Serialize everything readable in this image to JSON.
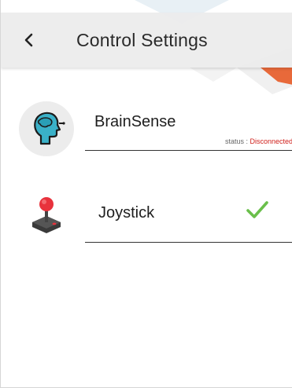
{
  "header": {
    "title": "Control Settings"
  },
  "devices": [
    {
      "name": "BrainSense",
      "icon": "brain-head-icon",
      "status_label": "status : ",
      "status_value": "Disconnected",
      "status_color": "#d0211c"
    },
    {
      "name": "Joystick",
      "icon": "joystick-icon",
      "selected": true,
      "check_color": "#6abf4b"
    }
  ],
  "colors": {
    "header_bg": "#ececec",
    "accent_orange": "#e8693a",
    "brain_icon_teal": "#3ab1c8",
    "joystick_knob_red": "#e8323c"
  }
}
